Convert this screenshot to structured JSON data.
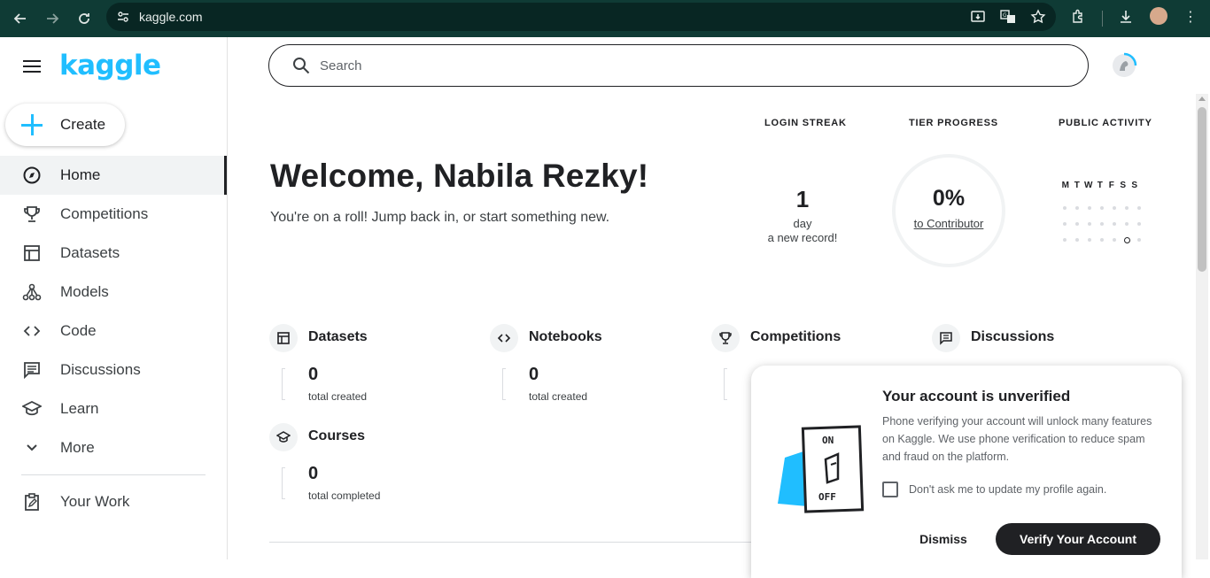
{
  "browser": {
    "url": "kaggle.com"
  },
  "sidebar": {
    "logo": "kaggle",
    "create_label": "Create",
    "items": [
      {
        "label": "Home",
        "icon": "compass-icon",
        "active": true
      },
      {
        "label": "Competitions",
        "icon": "trophy-icon"
      },
      {
        "label": "Datasets",
        "icon": "table-icon"
      },
      {
        "label": "Models",
        "icon": "models-icon"
      },
      {
        "label": "Code",
        "icon": "code-icon"
      },
      {
        "label": "Discussions",
        "icon": "discussions-icon"
      },
      {
        "label": "Learn",
        "icon": "learn-icon"
      },
      {
        "label": "More",
        "icon": "chevron-down-icon"
      }
    ],
    "your_work": "Your Work"
  },
  "header": {
    "search_placeholder": "Search"
  },
  "welcome": {
    "title": "Welcome, Nabila Rezky!",
    "subtitle": "You're on a roll! Jump back in, or start something new."
  },
  "stats": {
    "login_streak_label": "LOGIN STREAK",
    "streak_value": "1",
    "streak_unit": "day",
    "streak_note": "a new record!",
    "tier_label": "TIER PROGRESS",
    "tier_value": "0%",
    "tier_target": "to Contributor",
    "activity_label": "PUBLIC ACTIVITY",
    "days": [
      "M",
      "T",
      "W",
      "T",
      "F",
      "S",
      "S"
    ]
  },
  "sections": [
    {
      "title": "Datasets",
      "value": "0",
      "caption": "total created",
      "icon": "table-icon"
    },
    {
      "title": "Notebooks",
      "value": "0",
      "caption": "total created",
      "icon": "code-icon"
    },
    {
      "title": "Competitions",
      "value": "",
      "caption": "",
      "icon": "trophy-icon"
    },
    {
      "title": "Discussions",
      "value": "",
      "caption": "",
      "icon": "discussions-icon"
    },
    {
      "title": "Courses",
      "value": "0",
      "caption": "total completed",
      "icon": "learn-icon"
    }
  ],
  "popup": {
    "title": "Your account is unverified",
    "body": "Phone verifying your account will unlock many features on Kaggle. We use phone verification to reduce spam and fraud on the platform.",
    "illus_on": "ON",
    "illus_off": "OFF",
    "checkbox_label": "Don't ask me to update my profile again.",
    "dismiss_label": "Dismiss",
    "verify_label": "Verify Your Account"
  },
  "colors": {
    "brand": "#20beff",
    "chrome": "#0f3b35",
    "text": "#202124"
  }
}
